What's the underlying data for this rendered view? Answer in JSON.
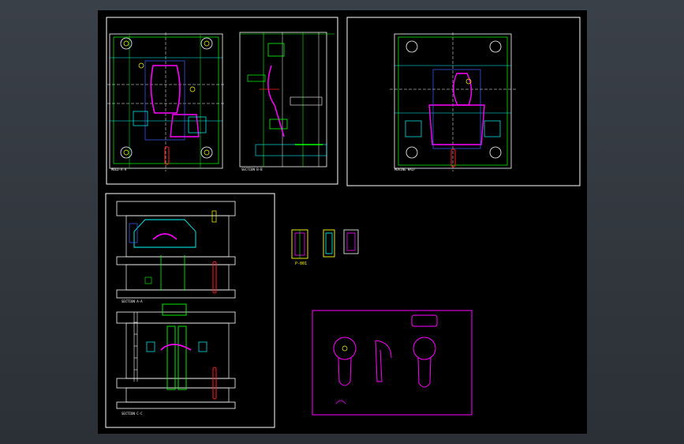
{
  "viewport": {
    "background": "#2e3339",
    "model_space_background": "#000000"
  },
  "colors": {
    "white": "#ffffff",
    "green": "#00ff00",
    "cyan": "#00ffff",
    "yellow": "#ffff00",
    "magenta": "#ff00ff",
    "red": "#ff2020",
    "blue": "#4060ff",
    "gray": "#a0a0a0"
  },
  "sheets": [
    {
      "id": "sheet-top-left",
      "views": [
        "plan-view",
        "section-view"
      ]
    },
    {
      "id": "sheet-top-right",
      "views": [
        "plan-view-moving-half"
      ]
    },
    {
      "id": "sheet-bottom-left",
      "views": [
        "section-a",
        "section-b"
      ]
    },
    {
      "id": "inserts-group",
      "views": [
        "insert-1",
        "insert-2",
        "insert-3"
      ]
    },
    {
      "id": "sheet-product",
      "views": [
        "product-front",
        "product-side",
        "product-back"
      ]
    }
  ],
  "view_labels": {
    "plan_left": "MOLD-A-A",
    "section_mid": "SECTION B-B",
    "plan_right": "MOVING HALF",
    "section_a": "SECTION A-A",
    "section_b": "SECTION C-C",
    "insert_tag": "P-001"
  }
}
